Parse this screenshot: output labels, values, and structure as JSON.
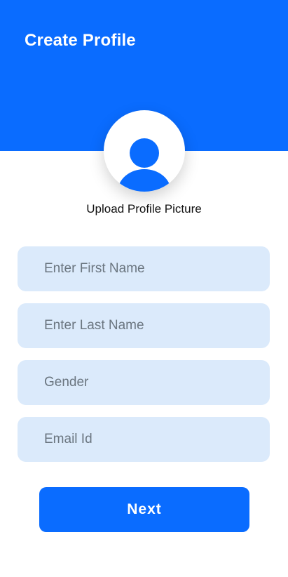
{
  "header": {
    "title": "Create Profile"
  },
  "avatar": {
    "icon": "user-silhouette-icon",
    "label": "Upload Profile Picture"
  },
  "form": {
    "fields": [
      {
        "name": "first_name",
        "placeholder": "Enter First Name",
        "value": ""
      },
      {
        "name": "last_name",
        "placeholder": "Enter Last Name",
        "value": ""
      },
      {
        "name": "gender",
        "placeholder": "Gender",
        "value": ""
      },
      {
        "name": "email",
        "placeholder": "Email Id",
        "value": ""
      }
    ]
  },
  "actions": {
    "next_label": "Next"
  },
  "colors": {
    "primary": "#0a6cff",
    "field_background": "#dbeafb",
    "background": "#ffffff"
  }
}
